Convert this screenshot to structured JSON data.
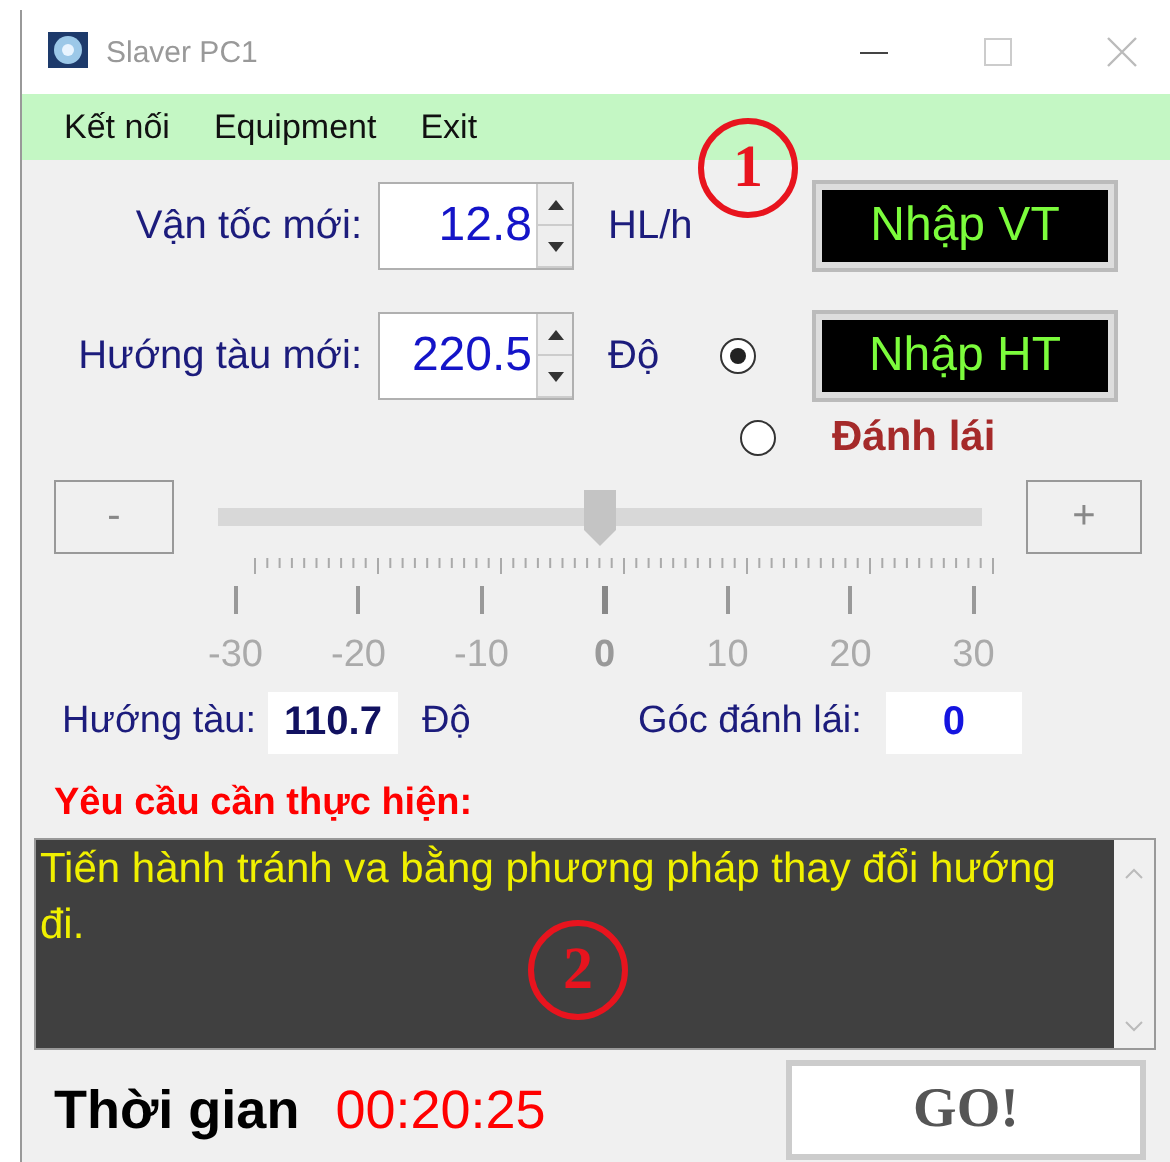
{
  "window": {
    "title": "Slaver PC1"
  },
  "menu": [
    "Kết nối",
    "Equipment",
    "Exit"
  ],
  "inputs": [
    {
      "label": "Vận tốc mới:",
      "value": "12.8",
      "unit": "HL/h",
      "button": "Nhập VT"
    },
    {
      "label": "Hướng tàu mới:",
      "value": "220.5",
      "unit": "Độ",
      "button": "Nhập HT"
    }
  ],
  "modes": [
    {
      "selected": true
    },
    {
      "label": "Đánh lái",
      "selected": false
    }
  ],
  "rudder": {
    "minus": "-",
    "plus": "+",
    "level": 0.5,
    "ticks": [
      {
        "label": "-30",
        "current": false
      },
      {
        "label": "-20",
        "current": false
      },
      {
        "label": "-10",
        "current": false
      },
      {
        "label": "0",
        "current": true
      },
      {
        "label": "10",
        "current": false
      },
      {
        "label": "20",
        "current": false
      },
      {
        "label": "30",
        "current": false
      }
    ]
  },
  "readouts": {
    "heading_label": "Hướng tàu:",
    "heading_value": "110.7",
    "heading_unit": "Độ",
    "rudder_label": "Góc đánh lái:",
    "rudder_value": "0"
  },
  "task": {
    "title": "Yêu cầu cần thực hiện:",
    "text": "Tiến hành tránh va bằng phương pháp thay đổi hướng đi."
  },
  "timer": {
    "label": "Thời gian",
    "value": "00:20:25"
  },
  "go_button": "GO!",
  "annotations": [
    "1",
    "2"
  ]
}
